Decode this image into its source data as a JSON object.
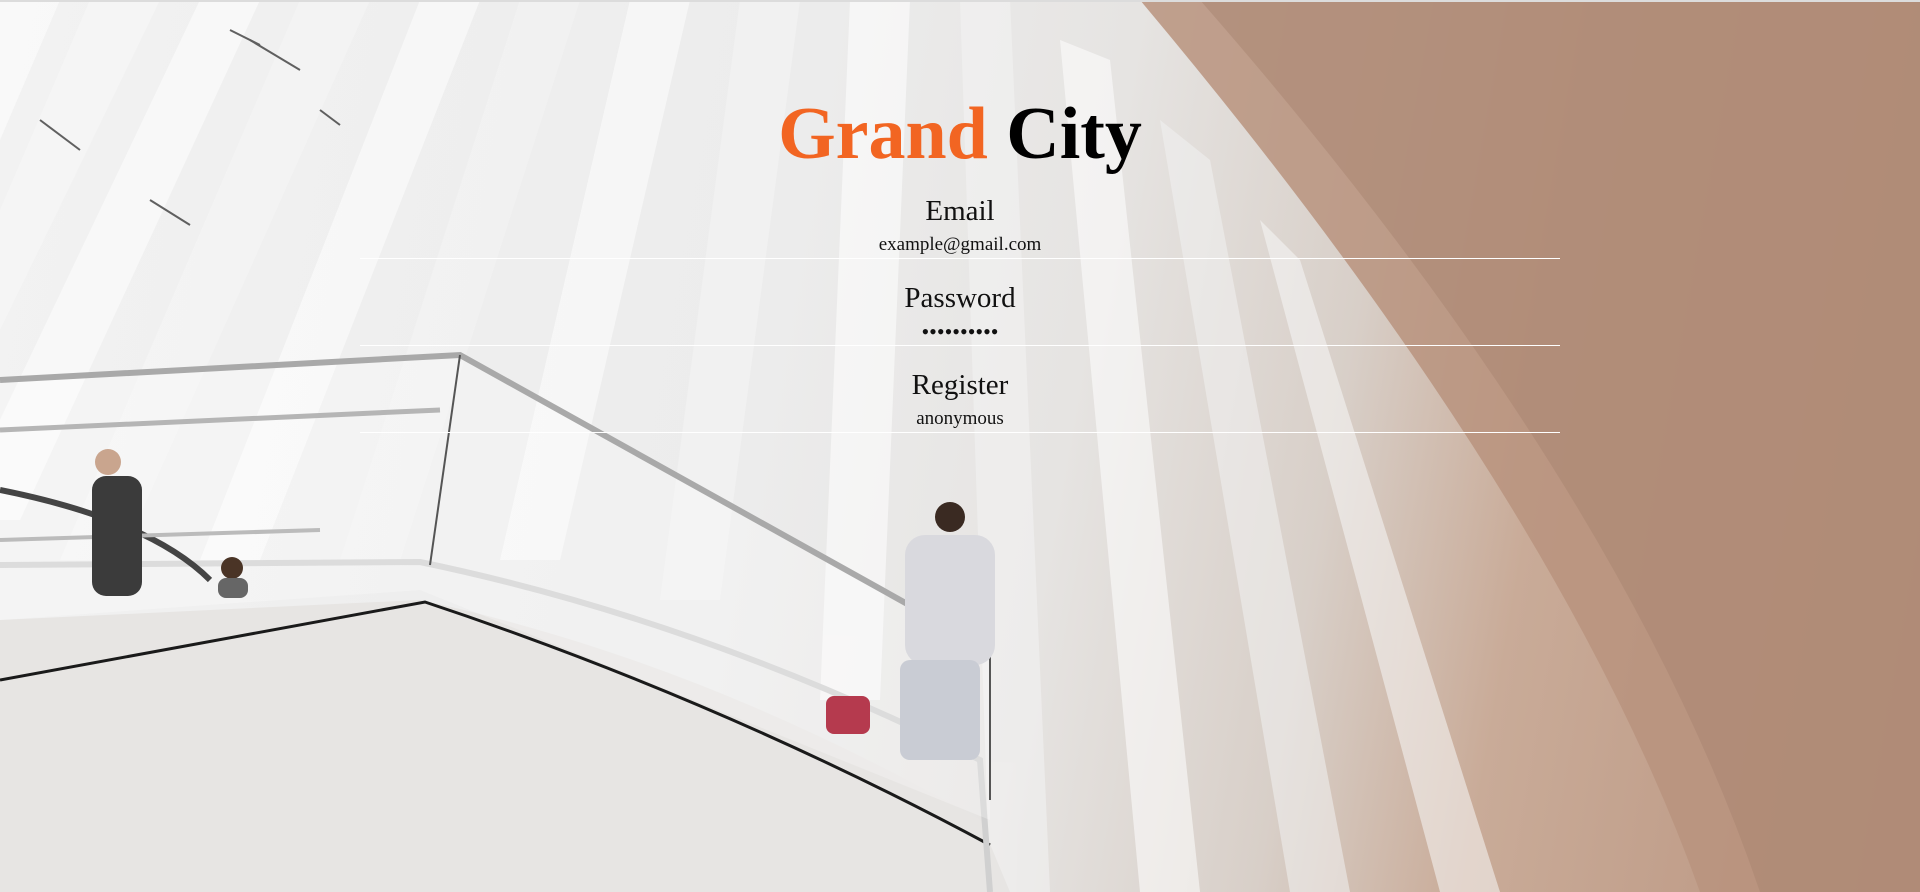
{
  "title": {
    "part1": "Grand",
    "part2": "City"
  },
  "colors": {
    "accent": "#f26522",
    "dark": "#000000"
  },
  "fields": [
    {
      "label": "Email",
      "value": "example@gmail.com"
    },
    {
      "label": "Password",
      "value": "••••••••••"
    },
    {
      "label": "Register",
      "value": "anonymous"
    }
  ],
  "background": {
    "description_icon": "architecture-photo"
  }
}
